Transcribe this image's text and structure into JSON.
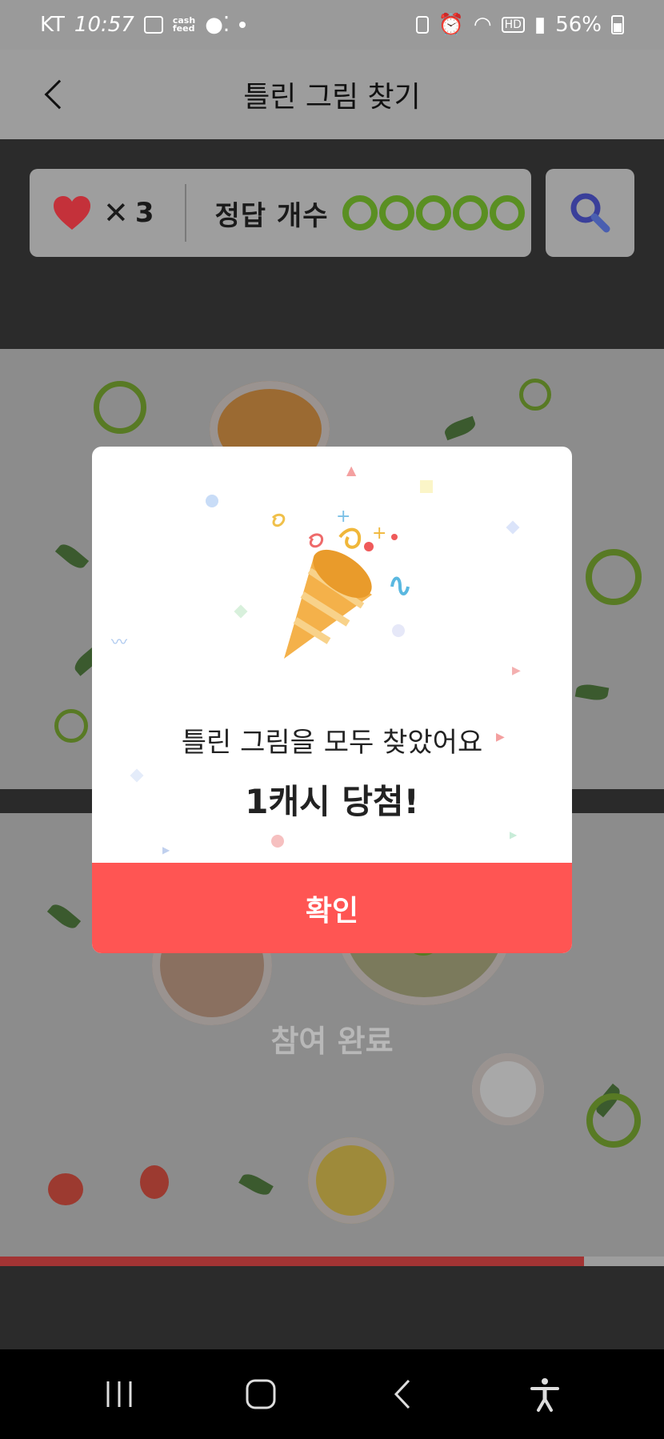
{
  "status_bar": {
    "carrier": "KT",
    "time": "10:57",
    "battery": "56%",
    "hd_badge": "HD",
    "cashfeed_label": "cash\nfeed"
  },
  "header": {
    "title": "틀린 그림 찾기",
    "back_icon": "chevron-left-icon"
  },
  "game_info": {
    "lives_symbol": "✕",
    "lives_count": "3",
    "answer_label": "정답 개수",
    "answers_found": 5,
    "answers_total": 5,
    "ring_color": "#5a8f22",
    "heart_color": "#c4313a",
    "hint_icon": "magnifier-icon"
  },
  "image_panel": {
    "completed_text": "참여 완료"
  },
  "progress": {
    "fraction": 0.88,
    "color": "#a33434"
  },
  "modal": {
    "message": "틀린 그림을 모두 찾았어요",
    "prize": "1캐시 당첨!",
    "confirm_label": "확인",
    "confirm_color": "#ff5553",
    "illustration": "party-popper-icon"
  },
  "nav": {
    "recents_icon": "recents-icon",
    "home_icon": "home-icon",
    "back_icon": "back-icon",
    "accessibility_icon": "accessibility-icon"
  }
}
